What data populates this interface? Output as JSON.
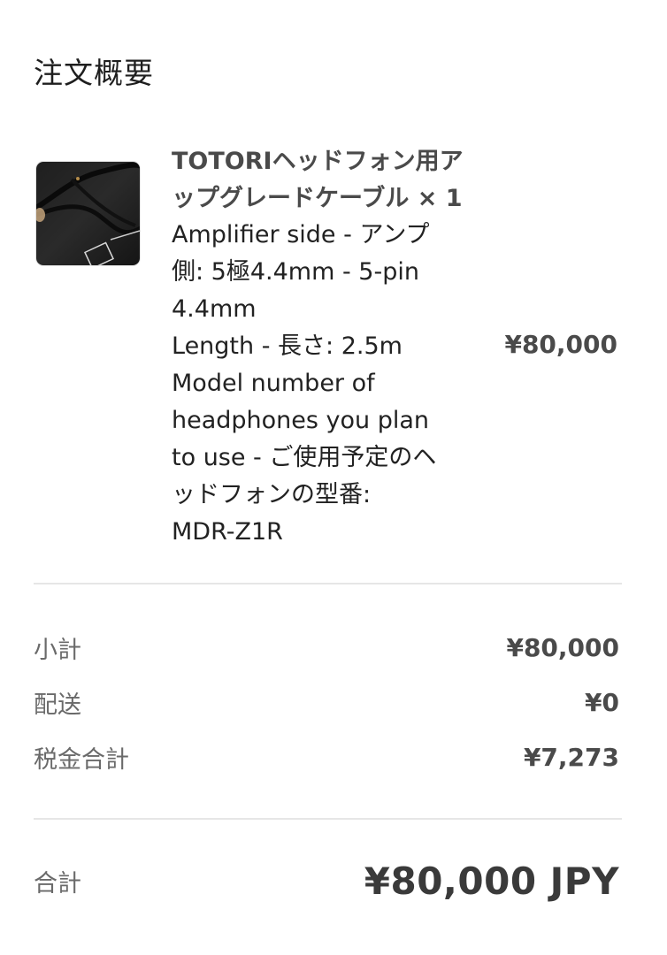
{
  "order_summary": {
    "heading": "注文概要",
    "product": {
      "title_line1": "TOTORIヘッドフォン用ア",
      "title_line2": "ップグレードケーブル × 1",
      "detail_lines": [
        "Amplifier side - アンプ",
        "側: 5極4.4mm - 5-pin",
        "4.4mm",
        "Length - 長さ: 2.5m",
        "Model number of",
        "headphones you plan",
        "to use - ご使用予定のヘ",
        "ッドフォンの型番:",
        "MDR-Z1R"
      ],
      "price": "¥80,000"
    },
    "lines": [
      {
        "label": "小計",
        "value": "¥80,000"
      },
      {
        "label": "配送",
        "value": "¥0"
      },
      {
        "label": "税金合計",
        "value": "¥7,273"
      }
    ],
    "total": {
      "label": "合計",
      "value": "¥80,000 JPY"
    }
  }
}
